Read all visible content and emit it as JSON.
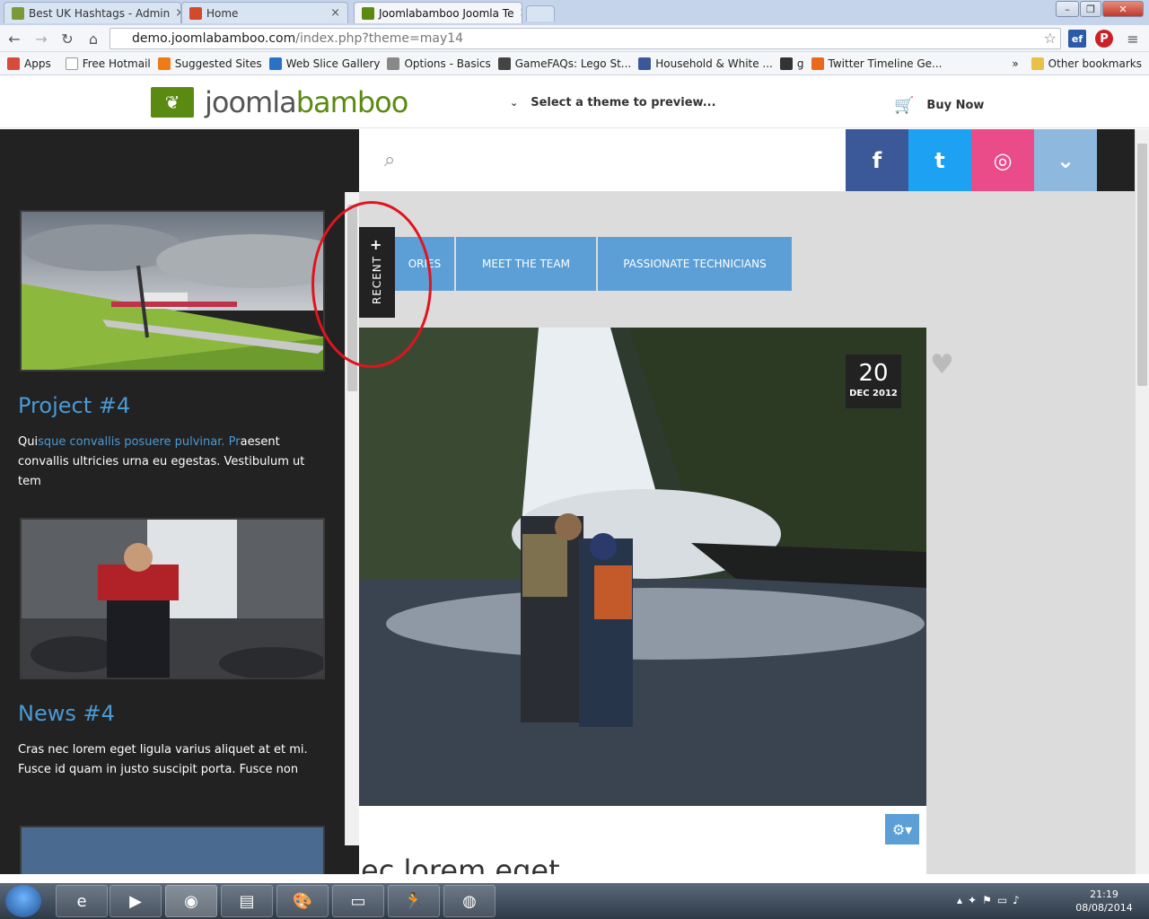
{
  "browser": {
    "tabs": [
      {
        "title": "Best UK Hashtags - Admin",
        "color": "#7a9a3a"
      },
      {
        "title": "Home",
        "color": "#d24a2b"
      },
      {
        "title": "Joomlabamboo Joomla Te",
        "color": "#5a8a12"
      }
    ],
    "url_host": "demo.joomlabamboo.com",
    "url_rest": "/index.php?theme=may14"
  },
  "bookmarks": [
    {
      "label": "Apps",
      "color": "#d84a3a"
    },
    {
      "label": "Free Hotmail",
      "color": "#ffffff"
    },
    {
      "label": "Suggested Sites",
      "color": "#f07a16"
    },
    {
      "label": "Web Slice Gallery",
      "color": "#2a72c8"
    },
    {
      "label": "Options - Basics",
      "color": "#666666"
    },
    {
      "label": "GameFAQs: Lego St...",
      "color": "#444444"
    },
    {
      "label": "Household & White ...",
      "color": "#3b5998"
    },
    {
      "label": "g",
      "color": "#333333"
    },
    {
      "label": "Twitter Timeline Ge...",
      "color": "#e86a1a"
    }
  ],
  "bookmarks_more": "»",
  "bookmarks_other": "Other bookmarks",
  "site": {
    "logo_a": "joomla",
    "logo_b": "bamboo",
    "theme_select": "Select a theme to preview...",
    "buy_now": "Buy Now"
  },
  "sidebar": {
    "cards": [
      {
        "title": "Project #4",
        "text_a": " Qui",
        "text_hl": "sque convallis posuere pulvinar. Pr",
        "text_b": "aesent convallis ultricies urna eu egestas. Vestibulum ut tem"
      },
      {
        "title": "News #4",
        "text_a": "Cras nec lorem eget ligula varius aliquet at et mi. Fusce id quam in justo suscipit porta. Fusce non",
        "text_hl": "",
        "text_b": ""
      }
    ]
  },
  "recent": {
    "plus": "+",
    "label": "RECENT"
  },
  "main": {
    "social": [
      {
        "name": "facebook",
        "glyph": "f",
        "color": "#3b5998"
      },
      {
        "name": "twitter",
        "glyph": "t",
        "color": "#1da1f2"
      },
      {
        "name": "dribbble",
        "glyph": "◎",
        "color": "#ea4c89"
      },
      {
        "name": "more",
        "glyph": "⌄",
        "color": "#8fb8de"
      }
    ],
    "nav_tabs": [
      "ORIES",
      "MEET THE TEAM",
      "PASSIONATE TECHNICIANS"
    ],
    "date_day": "20",
    "date_month": "DEC 2012",
    "post_title": "ec lorem eget"
  },
  "taskbar": {
    "time": "21:19",
    "date": "08/08/2014"
  }
}
